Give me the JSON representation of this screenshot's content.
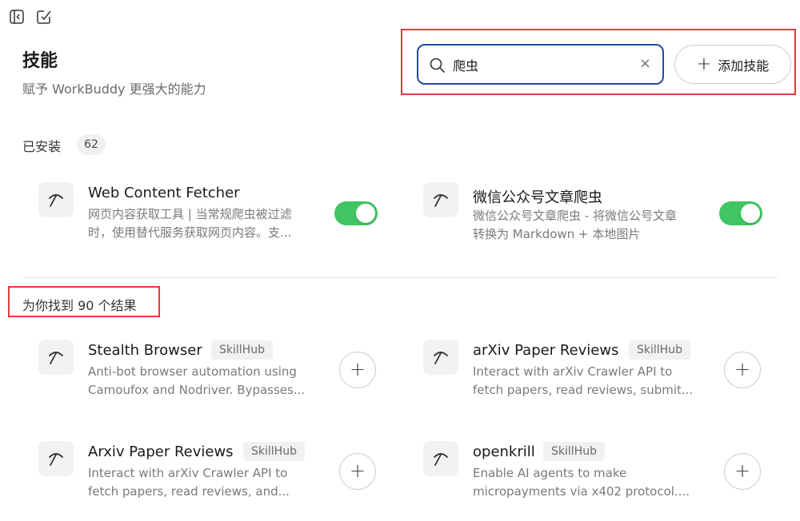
{
  "header": {
    "title": "技能",
    "subtitle": "赋予 WorkBuddy 更强大的能力"
  },
  "search": {
    "value": "爬虫",
    "clear_glyph": "×"
  },
  "add_skill_button": {
    "plus": "+",
    "label": "添加技能"
  },
  "installed": {
    "label": "已安装",
    "count": "62",
    "items": [
      {
        "title": "Web Content Fetcher",
        "desc_line1": "网页内容获取工具 | 当常规爬虫被过滤",
        "desc_line2": "时，使用替代服务获取网页内容。支...",
        "enabled": true
      },
      {
        "title": "微信公众号文章爬虫",
        "desc_line1": "微信公众号文章爬虫 - 将微信公号文章",
        "desc_line2": "转换为 Markdown + 本地图片",
        "enabled": true
      }
    ]
  },
  "results": {
    "label": "为你找到 90 个结果",
    "items": [
      {
        "title": "Stealth Browser",
        "tag": "SkillHub",
        "desc_line1": "Anti-bot browser automation using",
        "desc_line2": "Camoufox and Nodriver. Bypasses..."
      },
      {
        "title": "arXiv Paper Reviews",
        "tag": "SkillHub",
        "desc_line1": "Interact with arXiv Crawler API to",
        "desc_line2": "fetch papers, read reviews, submit..."
      },
      {
        "title": "Arxiv Paper Reviews",
        "tag": "SkillHub",
        "desc_line1": "Interact with arXiv Crawler API to",
        "desc_line2": "fetch papers, read reviews, and..."
      },
      {
        "title": "openkrill",
        "tag": "SkillHub",
        "desc_line1": "Enable AI agents to make",
        "desc_line2": "micropayments via x402 protocol...."
      }
    ],
    "add_glyph": "+"
  },
  "colors": {
    "accent_border": "#1e4e9c",
    "highlight_red": "#e03b3b",
    "toggle_on": "#3fc561"
  },
  "icons": [
    "sidebar-toggle-icon",
    "compose-icon",
    "search-icon",
    "close-icon",
    "plus-icon",
    "pickaxe-icon"
  ]
}
